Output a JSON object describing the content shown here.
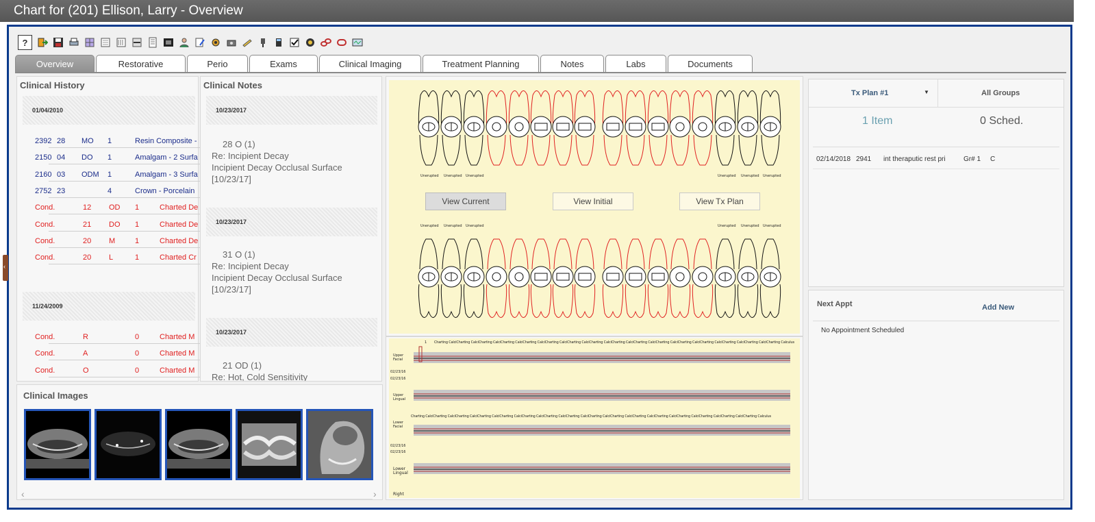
{
  "window": {
    "title": "Chart for (201) Ellison, Larry - Overview"
  },
  "toolbar": {
    "help_label": "?"
  },
  "tabs": [
    {
      "label": "Overview",
      "active": true
    },
    {
      "label": "Restorative"
    },
    {
      "label": "Perio"
    },
    {
      "label": "Exams"
    },
    {
      "label": "Clinical Imaging"
    },
    {
      "label": "Treatment Planning"
    },
    {
      "label": "Notes"
    },
    {
      "label": "Labs"
    },
    {
      "label": "Documents"
    }
  ],
  "clinical_history": {
    "title": "Clinical History",
    "groups": [
      {
        "date": "01/04/2010",
        "rows": [
          {
            "c1": "2392",
            "c2": "28",
            "c3": "MO",
            "c4": "1",
            "c5": "Resin Composite -",
            "color": "blue"
          },
          {
            "c1": "2150",
            "c2": "04",
            "c3": "DO",
            "c4": "1",
            "c5": "Amalgam - 2 Surfa",
            "color": "blue"
          },
          {
            "c1": "2160",
            "c2": "03",
            "c3": "ODM",
            "c4": "1",
            "c5": "Amalgam - 3 Surfa",
            "color": "blue"
          },
          {
            "c1": "2752",
            "c2": "23",
            "c3": "",
            "c4": "4",
            "c5": "Crown - Porcelain",
            "color": "blue"
          },
          {
            "c1": "Cond.",
            "c2": "12",
            "c3": "OD",
            "c4": "1",
            "c5": "Charted De",
            "color": "red"
          },
          {
            "c1": "Cond.",
            "c2": "21",
            "c3": "DO",
            "c4": "1",
            "c5": "Charted De",
            "color": "red"
          },
          {
            "c1": "Cond.",
            "c2": "20",
            "c3": "M",
            "c4": "1",
            "c5": "Charted De",
            "color": "red"
          },
          {
            "c1": "Cond.",
            "c2": "20",
            "c3": "L",
            "c4": "1",
            "c5": "Charted Cr",
            "color": "red"
          }
        ]
      },
      {
        "date": "11/24/2009",
        "rows": [
          {
            "c1": "Cond.",
            "c2": "R",
            "c3": "",
            "c4": "0",
            "c5": "Charted M",
            "color": "red"
          },
          {
            "c1": "Cond.",
            "c2": "A",
            "c3": "",
            "c4": "0",
            "c5": "Charted M",
            "color": "red"
          },
          {
            "c1": "Cond.",
            "c2": "O",
            "c3": "",
            "c4": "0",
            "c5": "Charted M",
            "color": "red"
          }
        ]
      }
    ]
  },
  "clinical_notes": {
    "title": "Clinical Notes",
    "notes": [
      {
        "date": "10/23/2017",
        "lines": [
          "28   O   (1)",
          "Re: Incipient Decay",
          "Incipient Decay Occlusal Surface",
          "[10/23/17]"
        ]
      },
      {
        "date": "10/23/2017",
        "lines": [
          "31   O   (1)",
          "Re: Incipient Decay",
          "Incipient Decay Occlusal Surface",
          "[10/23/17]"
        ]
      },
      {
        "date": "10/23/2017",
        "lines": [
          "21   OD   (1)",
          "Re: Hot, Cold Sensitivity"
        ]
      }
    ]
  },
  "clinical_images": {
    "title": "Clinical Images",
    "scroll_left": "‹",
    "scroll_right": "›"
  },
  "tooth_chart": {
    "view_current": "View Current",
    "view_initial": "View Initial",
    "view_tx_plan": "View Tx Plan",
    "unerupted": "Unerupted"
  },
  "perio_chart": {
    "label_upper_facial": [
      "Upper",
      "Facial"
    ],
    "label_upper_lingual": [
      "Upper",
      "Lingual"
    ],
    "label_lower_facial": [
      "Lower",
      "Facial"
    ],
    "label_lower_lingual": [
      "Lower",
      "Lingual"
    ],
    "date_a": "02/23/16",
    "date_b": "02/23/16",
    "label_right": "Right",
    "col_one": "1",
    "charting_word": "Charting",
    "calc_word": "Calculus",
    "row_text": "Charting CalciCharting CalciCharting CalciCharting CalciCharting CalciCharting CalciCharting CalciCharting CalciCharting CalciCharting CalciCharting CalciCharting CalciCharting CalciCharting CalciCharting CalciCharting Calculus"
  },
  "tx_plan": {
    "plan_label": "Tx Plan #1",
    "all_groups": "All Groups",
    "items_count": "1 Item",
    "sched_count": "0 Sched.",
    "row": {
      "date": "02/14/2018",
      "code": "2941",
      "desc": "int theraputic rest pri",
      "gr": "Gr# 1",
      "status": "C"
    }
  },
  "next_appt": {
    "title": "Next Appt",
    "add_new": "Add New",
    "empty": "No Appointment Scheduled"
  },
  "colors": {
    "frame": "#0a3a8c",
    "chart_bg": "#fbf6cd",
    "red": "#e02020",
    "blue": "#1a2c8a"
  }
}
